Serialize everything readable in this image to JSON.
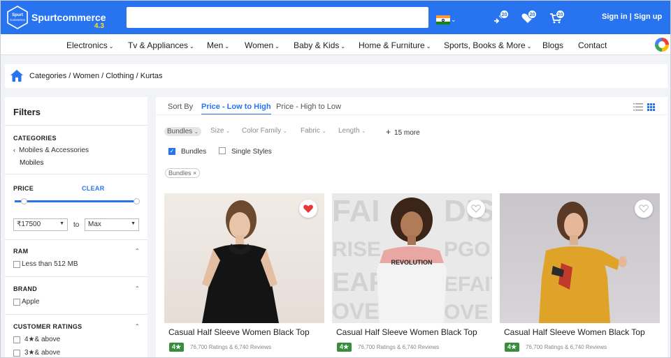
{
  "header": {
    "logo_text": "Spurtcommerce",
    "logo_badge_line1": "Spurt",
    "logo_badge_line2": "Commerce",
    "version": "4.3",
    "search_value": "",
    "wishlist_count": "20",
    "compare_count": "20",
    "cart_count": "20",
    "auth_text": "Sign in | Sign up",
    "accent_color": "#2874f0"
  },
  "nav": {
    "items": [
      {
        "label": "Electronics",
        "dropdown": true
      },
      {
        "label": "Tv & Appliances",
        "dropdown": true
      },
      {
        "label": "Men",
        "dropdown": true
      },
      {
        "label": "Women",
        "dropdown": true
      },
      {
        "label": "Baby & Kids",
        "dropdown": true
      },
      {
        "label": "Home & Furniture",
        "dropdown": true
      },
      {
        "label": "Sports, Books & More",
        "dropdown": true
      },
      {
        "label": "Blogs",
        "dropdown": false
      },
      {
        "label": "Contact",
        "dropdown": false
      }
    ]
  },
  "breadcrumb": {
    "text": "Categories / Women / Clothing / Kurtas"
  },
  "filters": {
    "title": "Filters",
    "categories_heading": "CATEGORIES",
    "category_parent": "Mobiles & Accessories",
    "category_child": "Mobiles",
    "price_heading": "PRICE",
    "clear_label": "CLEAR",
    "price_min": "₹17500",
    "to_label": "to",
    "price_max": "Max",
    "ram_heading": "RAM",
    "ram_option": "Less than 512 MB",
    "brand_heading": "BRAND",
    "brand_option": "Apple",
    "ratings_heading": "CUSTOMER RATINGS",
    "rating_option_1": "4★& above",
    "rating_option_2": "3★& above"
  },
  "sort": {
    "label": "Sort By",
    "options": [
      "Price - Low to High",
      "Price - High to Low"
    ],
    "active": "Price - Low to High"
  },
  "facets": {
    "chips": [
      "Bundles",
      "Size",
      "Color Family",
      "Fabric",
      "Length"
    ],
    "more": "15 more",
    "bundles_checked": true,
    "bundles_label": "Bundles",
    "single_styles_label": "Single Styles",
    "applied_tag": "Bundles ×"
  },
  "products": [
    {
      "title": "Casual Half Sleeve Women Black Top",
      "rating": "4★",
      "reviews": "76,700 Ratings & 6,740 Reviews",
      "wishlisted": true
    },
    {
      "title": "Casual Half Sleeve Women Black Top",
      "rating": "4★",
      "reviews": "76,700 Ratings & 6,740 Reviews",
      "wishlisted": false,
      "shirt_text": "REVOLUTION"
    },
    {
      "title": "Casual Half Sleeve Women Black Top",
      "rating": "4★",
      "reviews": "76,700 Ratings & 6,740 Reviews",
      "wishlisted": false
    }
  ]
}
